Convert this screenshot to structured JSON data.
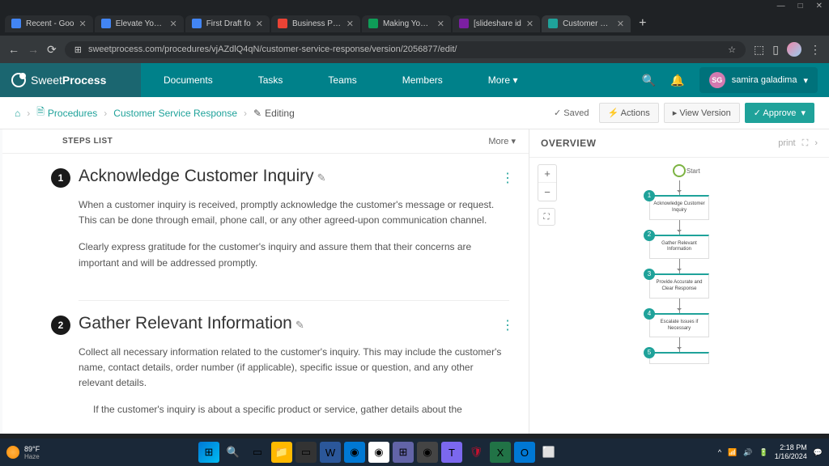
{
  "window": {
    "minimize": "—",
    "maximize": "□",
    "close": "✕"
  },
  "tabs": [
    {
      "title": "Recent - Goo",
      "favicon": "#4285f4"
    },
    {
      "title": "Elevate Your I",
      "favicon": "#4285f4"
    },
    {
      "title": "First Draft fo",
      "favicon": "#4285f4"
    },
    {
      "title": "Business Proc",
      "favicon": "#ea4335"
    },
    {
      "title": "Making Your S",
      "favicon": "#0f9d58"
    },
    {
      "title": "[slideshare id",
      "favicon": "#7b1fa2"
    },
    {
      "title": "Customer Ser",
      "favicon": "#1fa29a",
      "active": true
    }
  ],
  "url": "sweetprocess.com/procedures/vjAZdlQ4qN/customer-service-response/version/2056877/edit/",
  "brand": {
    "a": "Sweet",
    "b": "Process"
  },
  "nav": {
    "docs": "Documents",
    "tasks": "Tasks",
    "teams": "Teams",
    "members": "Members",
    "more": "More"
  },
  "user": {
    "initials": "SG",
    "name": "samira galadima"
  },
  "breadcrumb": {
    "procedures": "Procedures",
    "procedure": "Customer Service Response",
    "editing": "Editing",
    "saved": "Saved",
    "actions": "Actions",
    "view": "View Version",
    "approve": "Approve"
  },
  "steps": {
    "header": "STEPS LIST",
    "more": "More",
    "items": [
      {
        "num": "1",
        "title": "Acknowledge Customer Inquiry",
        "p1": "When a customer inquiry is received, promptly acknowledge the customer's message or request. This can be done through email, phone call, or any other agreed-upon communication channel.",
        "p2": "Clearly express gratitude for the customer's inquiry and assure them that their concerns are important and will be addressed promptly."
      },
      {
        "num": "2",
        "title": "Gather Relevant Information",
        "p1": "Collect all necessary information related to the customer's inquiry. This may include the customer's name, contact details, order number (if applicable), specific issue or question, and any other relevant details.",
        "p2": "If the customer's inquiry is about a specific product or service, gather details about the"
      }
    ]
  },
  "overview": {
    "title": "OVERVIEW",
    "print": "print",
    "start": "Start",
    "nodes": [
      {
        "n": "1",
        "t": "Acknowledge Customer Inquiry"
      },
      {
        "n": "2",
        "t": "Gather Relevant Information"
      },
      {
        "n": "3",
        "t": "Provide Accurate and Clear Response"
      },
      {
        "n": "4",
        "t": "Escalate Issues if Necessary"
      },
      {
        "n": "5",
        "t": ""
      }
    ]
  },
  "taskbar": {
    "temp": "89°F",
    "cond": "Haze",
    "time": "2:18 PM",
    "date": "1/16/2024"
  }
}
